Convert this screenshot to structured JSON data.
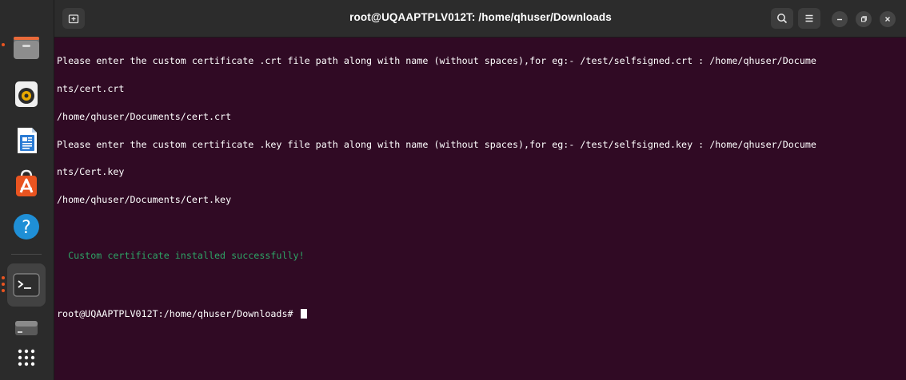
{
  "window": {
    "title": "root@UQAAPTPLV012T: /home/qhuser/Downloads"
  },
  "dock": {
    "items": [
      {
        "name": "files",
        "icon": "folder-icon",
        "running": true
      },
      {
        "name": "rhythmbox",
        "icon": "speaker-icon",
        "running": false
      },
      {
        "name": "libreoffice-writer",
        "icon": "document-icon",
        "running": false
      },
      {
        "name": "ubuntu-software",
        "icon": "store-icon",
        "running": false
      },
      {
        "name": "help",
        "icon": "help-icon",
        "running": false
      },
      {
        "name": "terminal",
        "icon": "terminal-icon",
        "running": true,
        "active": true
      },
      {
        "name": "drive",
        "icon": "drive-icon",
        "running": false
      },
      {
        "name": "show-apps",
        "icon": "grid-icon",
        "running": false
      }
    ]
  },
  "terminal": {
    "lines": [
      "Please enter the custom certificate .crt file path along with name (without spaces),for eg:- /test/selfsigned.crt : /home/qhuser/Docume",
      "nts/cert.crt",
      "/home/qhuser/Documents/cert.crt",
      "Please enter the custom certificate .key file path along with name (without spaces),for eg:- /test/selfsigned.key : /home/qhuser/Docume",
      "nts/Cert.key",
      "/home/qhuser/Documents/Cert.key"
    ],
    "success_message": "  Custom certificate installed successfully!",
    "prompt": "root@UQAAPTPLV012T:/home/qhuser/Downloads# "
  },
  "colors": {
    "terminal_bg": "#300a24",
    "headerbar_bg": "#2c2c2c",
    "dock_bg": "#2b2b2b",
    "success_text": "#2ea365",
    "accent": "#e95420"
  }
}
